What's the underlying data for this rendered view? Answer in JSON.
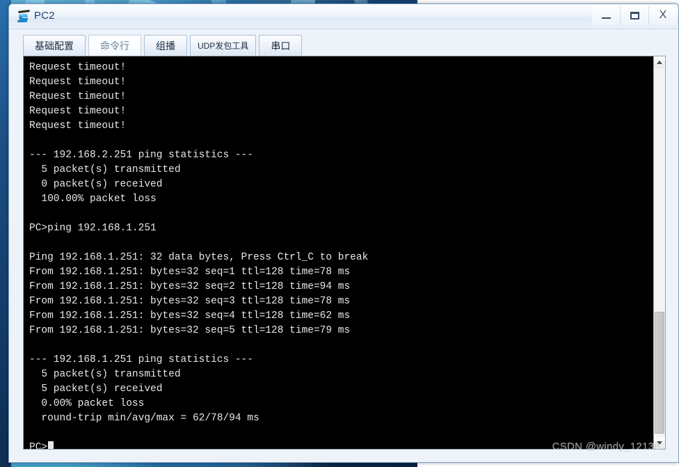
{
  "window": {
    "title": "PC2",
    "icon": "pc-device-icon",
    "buttons": {
      "minimize": "—",
      "maximize": "□",
      "close": "X"
    }
  },
  "tabs": [
    {
      "label": "基础配置",
      "active": false
    },
    {
      "label": "命令行",
      "active": true
    },
    {
      "label": "组播",
      "active": false
    },
    {
      "label": "UDP发包工具",
      "active": false
    },
    {
      "label": "串口",
      "active": false
    }
  ],
  "terminal": {
    "lines": [
      "Request timeout!",
      "Request timeout!",
      "Request timeout!",
      "Request timeout!",
      "Request timeout!",
      "",
      "--- 192.168.2.251 ping statistics ---",
      "  5 packet(s) transmitted",
      "  0 packet(s) received",
      "  100.00% packet loss",
      "",
      "PC>ping 192.168.1.251",
      "",
      "Ping 192.168.1.251: 32 data bytes, Press Ctrl_C to break",
      "From 192.168.1.251: bytes=32 seq=1 ttl=128 time=78 ms",
      "From 192.168.1.251: bytes=32 seq=2 ttl=128 time=94 ms",
      "From 192.168.1.251: bytes=32 seq=3 ttl=128 time=78 ms",
      "From 192.168.1.251: bytes=32 seq=4 ttl=128 time=62 ms",
      "From 192.168.1.251: bytes=32 seq=5 ttl=128 time=79 ms",
      "",
      "--- 192.168.1.251 ping statistics ---",
      "  5 packet(s) transmitted",
      "  5 packet(s) received",
      "  0.00% packet loss",
      "  round-trip min/avg/max = 62/78/94 ms",
      "",
      "PC>"
    ],
    "prompt": "PC>",
    "foreground": "#e8e8e8",
    "background": "#000000"
  },
  "scrollbar": {
    "up_arrow": "scroll-up",
    "down_arrow": "scroll-down"
  },
  "watermark": {
    "text": "CSDN @windy_12138"
  }
}
